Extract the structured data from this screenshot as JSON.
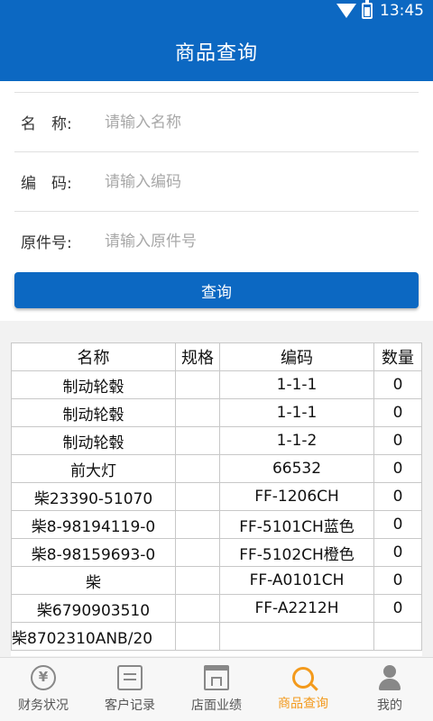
{
  "status_bar": {
    "time": "13:45"
  },
  "header": {
    "title": "商品查询"
  },
  "form": {
    "name_label": "名　称:",
    "name_placeholder": "请输入名称",
    "code_label": "编　码:",
    "code_placeholder": "请输入编码",
    "part_label": "原件号:",
    "part_placeholder": "请输入原件号",
    "query_button": "查询"
  },
  "table": {
    "headers": [
      "名称",
      "规格",
      "编码",
      "数量"
    ],
    "rows": [
      [
        "制动轮毂",
        "",
        "1-1-1",
        "0"
      ],
      [
        "制动轮毂",
        "",
        "1-1-1",
        "0"
      ],
      [
        "制动轮毂",
        "",
        "1-1-2",
        "0"
      ],
      [
        "前大灯",
        "",
        "66532",
        "0"
      ],
      [
        "柴23390-51070",
        "",
        "FF-1206CH",
        "0"
      ],
      [
        "柴8-98194119-0",
        "",
        "FF-5101CH蓝色",
        "0"
      ],
      [
        "柴8-98159693-0",
        "",
        "FF-5102CH橙色",
        "0"
      ],
      [
        "柴",
        "",
        "FF-A0101CH",
        "0"
      ],
      [
        "柴6790903510",
        "",
        "FF-A2212H",
        "0"
      ],
      [
        "柴8702310ANB/20",
        "",
        "",
        ""
      ]
    ]
  },
  "bottom_nav": {
    "items": [
      {
        "label": "财务状况",
        "icon": "money-icon",
        "active": false
      },
      {
        "label": "客户记录",
        "icon": "record-icon",
        "active": false
      },
      {
        "label": "店面业绩",
        "icon": "store-icon",
        "active": false
      },
      {
        "label": "商品查询",
        "icon": "search-icon",
        "active": true
      },
      {
        "label": "我的",
        "icon": "user-icon",
        "active": false
      }
    ],
    "active_color": "#f39a1c"
  },
  "colors": {
    "primary": "#0c68c2",
    "accent": "#f39a1c"
  }
}
